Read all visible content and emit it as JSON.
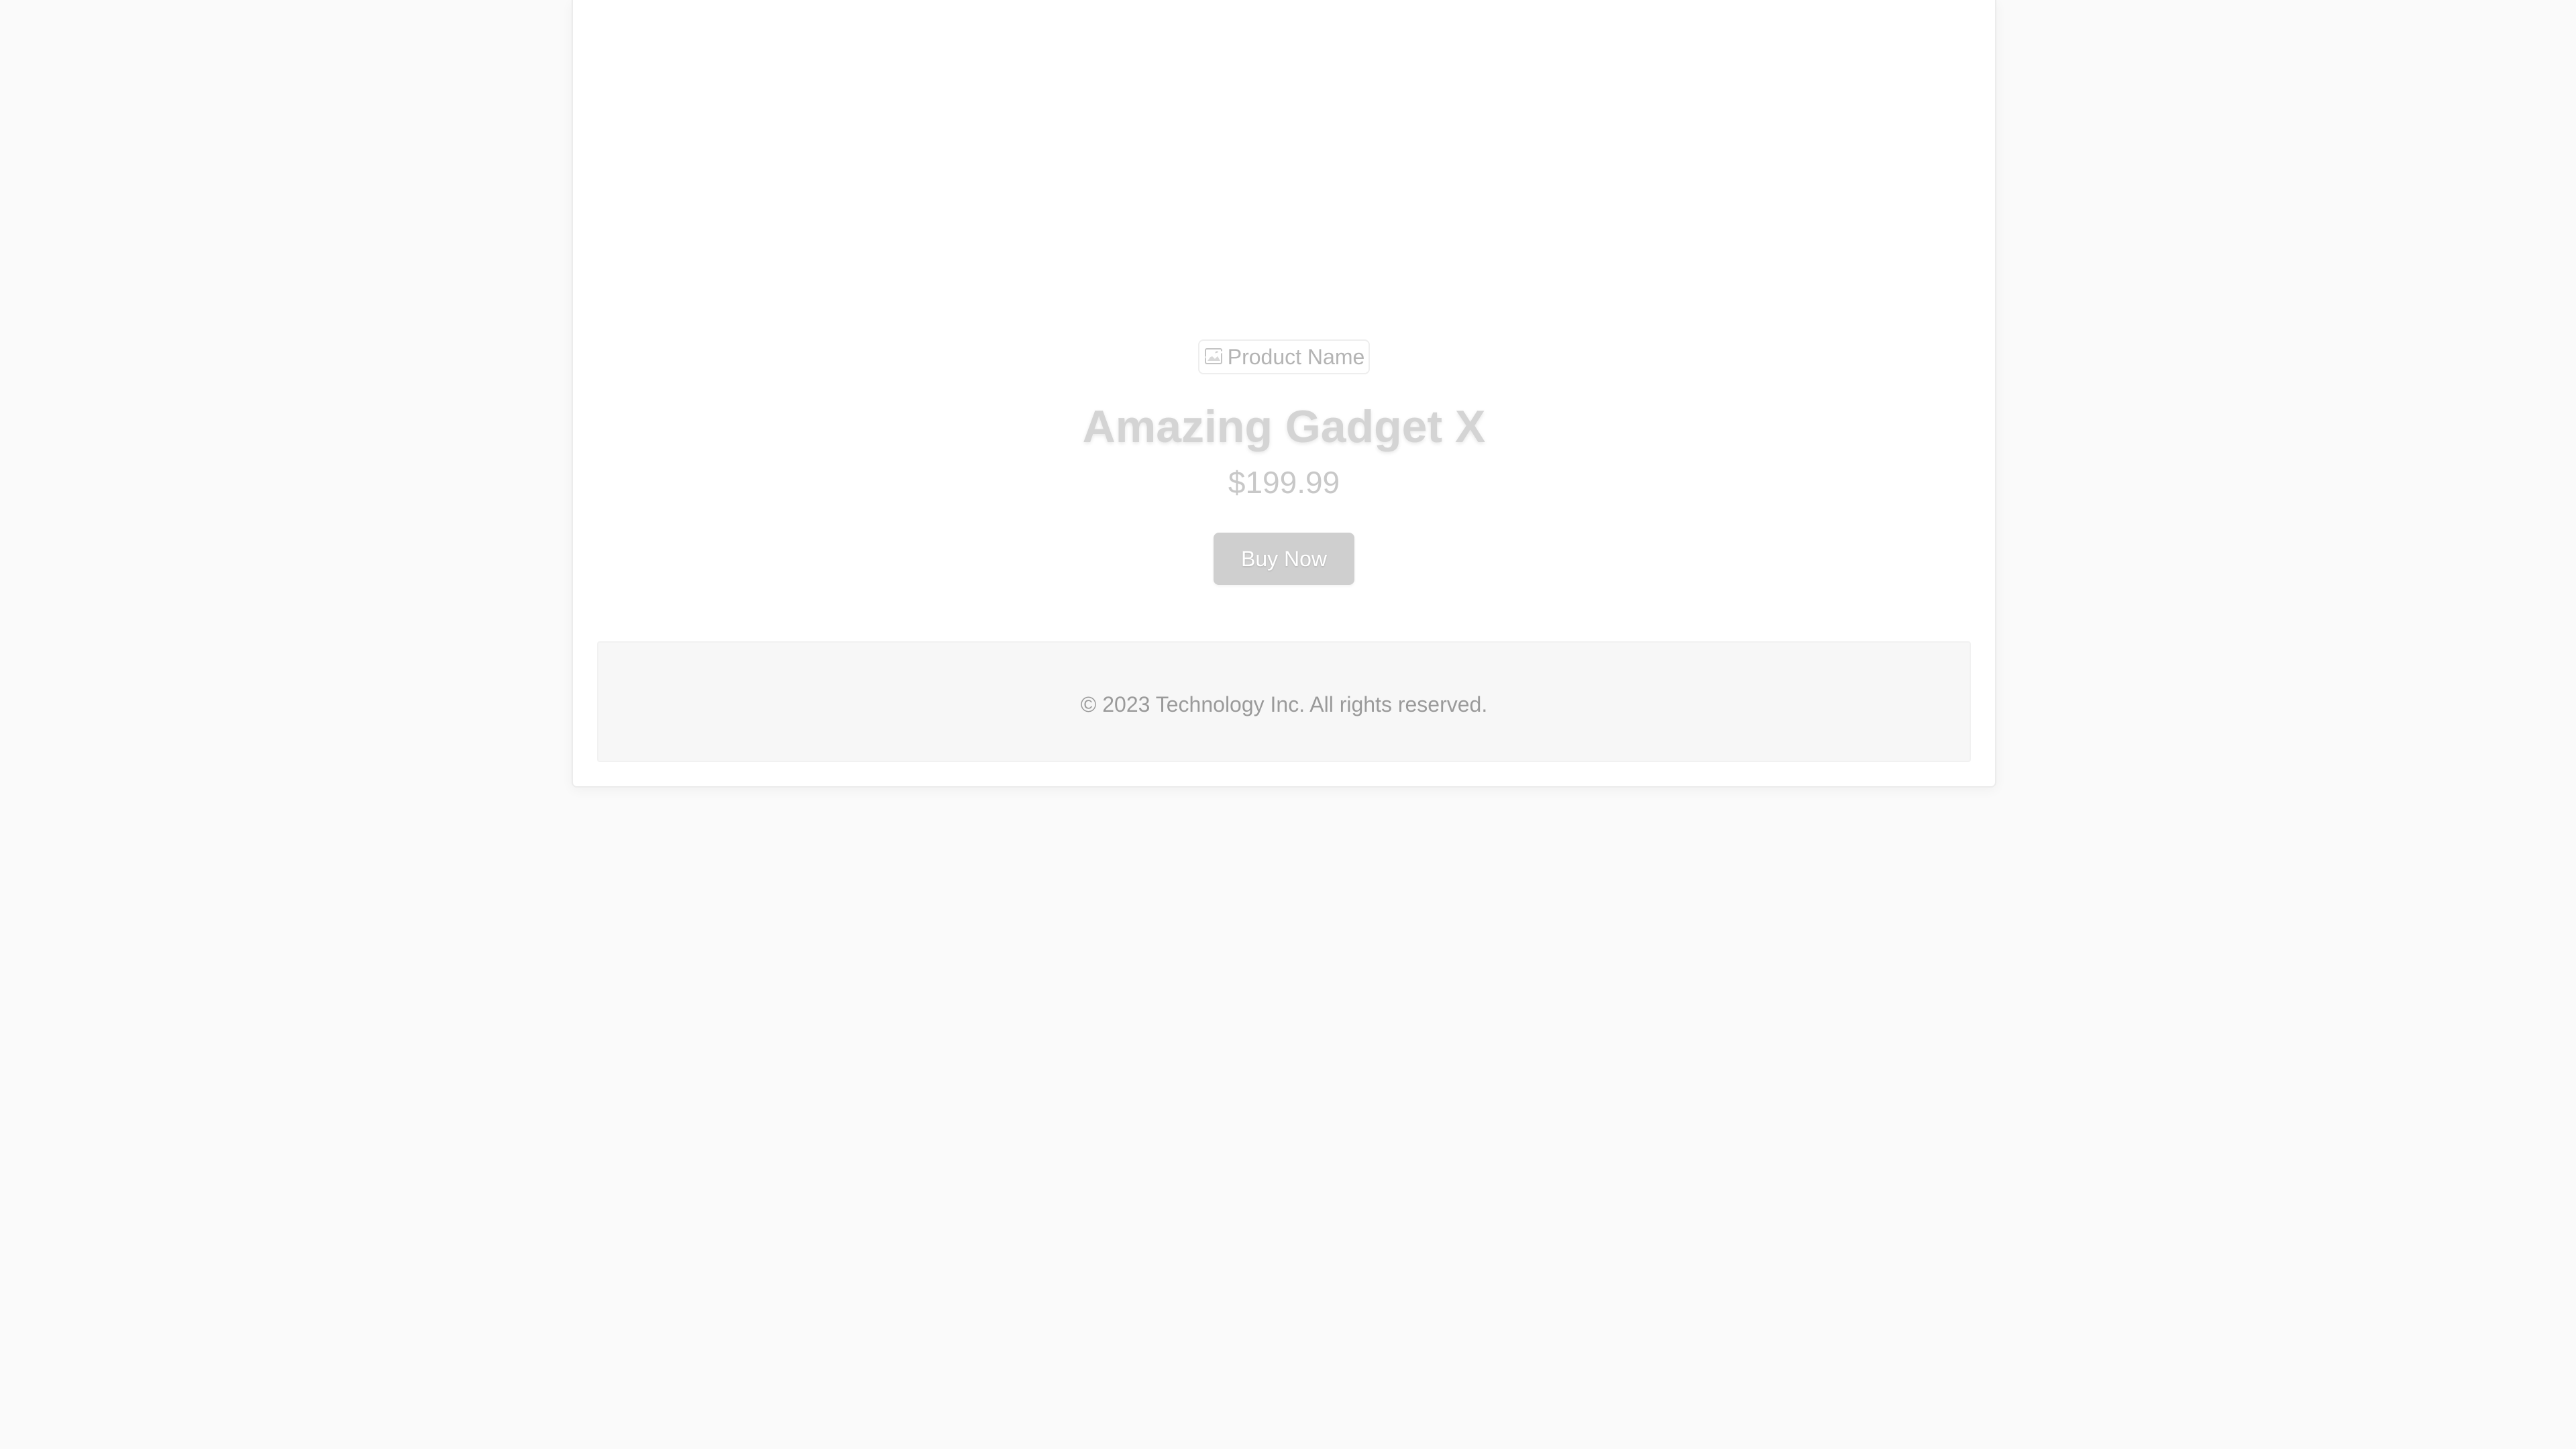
{
  "product": {
    "image_alt": "Product Name",
    "name": "Amazing Gadget X",
    "price": "$199.99",
    "buy_label": "Buy Now",
    "image_icon": "broken-image-icon"
  },
  "footer": {
    "text": "© 2023 Technology Inc. All rights reserved."
  },
  "colors": {
    "page_background": "#fafafa",
    "card_background": "#ffffff",
    "button_background": "#cfcfcf",
    "title_color": "#d4d4d4",
    "footer_background": "#f7f7f7"
  }
}
